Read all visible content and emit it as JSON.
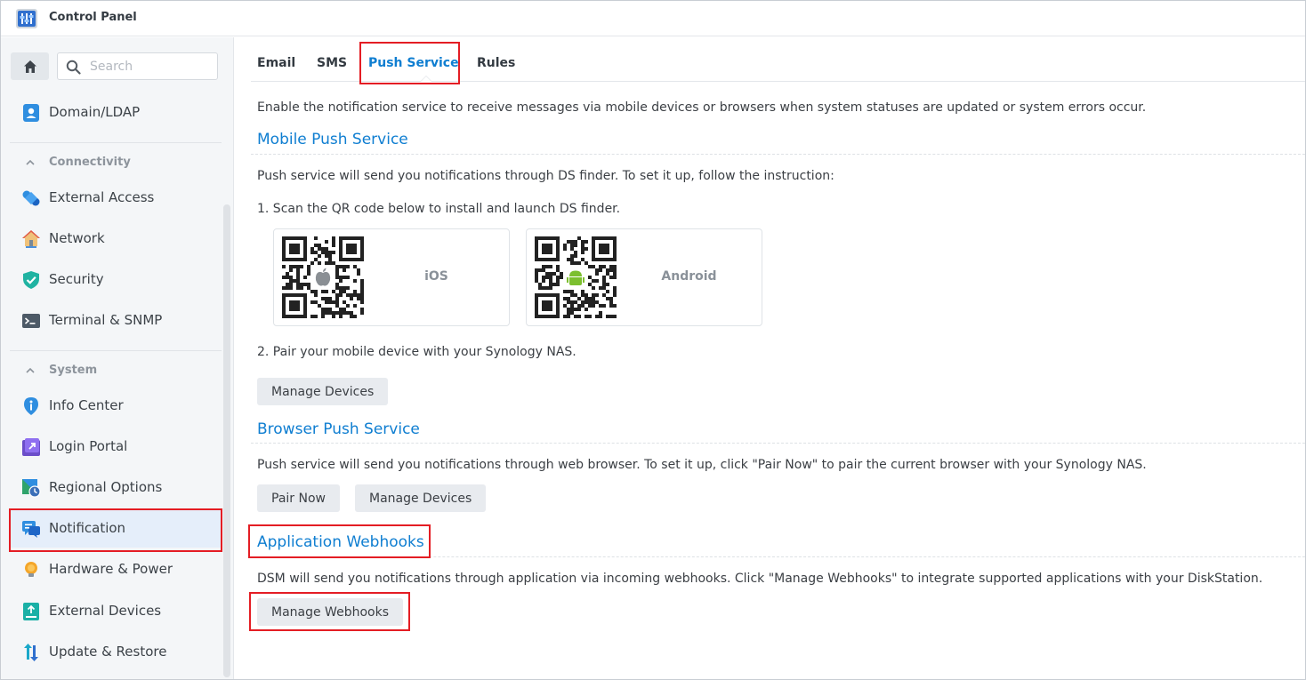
{
  "window": {
    "title": "Control Panel"
  },
  "sidebar": {
    "search_placeholder": "Search",
    "items_top": [
      {
        "label": "Domain/LDAP",
        "icon": "user-card-icon"
      }
    ],
    "groups": [
      {
        "label": "Connectivity",
        "items": [
          {
            "label": "External Access",
            "icon": "external-access-icon"
          },
          {
            "label": "Network",
            "icon": "house-network-icon"
          },
          {
            "label": "Security",
            "icon": "shield-check-icon"
          },
          {
            "label": "Terminal & SNMP",
            "icon": "terminal-icon"
          }
        ]
      },
      {
        "label": "System",
        "items": [
          {
            "label": "Info Center",
            "icon": "info-icon"
          },
          {
            "label": "Login Portal",
            "icon": "login-portal-icon"
          },
          {
            "label": "Regional Options",
            "icon": "regional-icon"
          },
          {
            "label": "Notification",
            "icon": "chat-bubbles-icon",
            "active": true
          },
          {
            "label": "Hardware & Power",
            "icon": "bulb-icon"
          },
          {
            "label": "External Devices",
            "icon": "external-device-icon"
          },
          {
            "label": "Update & Restore",
            "icon": "update-arrows-icon"
          }
        ]
      }
    ]
  },
  "tabs": [
    {
      "label": "Email",
      "active": false
    },
    {
      "label": "SMS",
      "active": false
    },
    {
      "label": "Push Service",
      "active": true
    },
    {
      "label": "Rules",
      "active": false
    }
  ],
  "content": {
    "intro": "Enable the notification service to receive messages via mobile devices or browsers when system statuses are updated or system errors occur.",
    "mobile": {
      "title": "Mobile Push Service",
      "desc": "Push service will send you notifications through DS finder. To set it up, follow the instruction:",
      "step1": "1. Scan the QR code below to install and launch DS finder.",
      "qr_cards": [
        {
          "platform": "iOS",
          "icon": "apple-icon"
        },
        {
          "platform": "Android",
          "icon": "android-icon"
        }
      ],
      "step2": "2. Pair your mobile device with your Synology NAS.",
      "manage_devices": "Manage Devices"
    },
    "browser": {
      "title": "Browser Push Service",
      "desc": "Push service will send you notifications through web browser. To set it up, click \"Pair Now\" to pair the current browser with your Synology NAS.",
      "pair_now": "Pair Now",
      "manage_devices": "Manage Devices"
    },
    "webhooks": {
      "title": "Application Webhooks",
      "desc": "DSM will send you notifications through application via incoming webhooks. Click \"Manage Webhooks\" to integrate supported applications with your DiskStation.",
      "manage_webhooks": "Manage Webhooks"
    }
  },
  "colors": {
    "accent": "#0f7ed1",
    "highlight": "#e41d24",
    "sidebar_bg": "#f4f6f8",
    "active_bg": "#e5eefa"
  }
}
